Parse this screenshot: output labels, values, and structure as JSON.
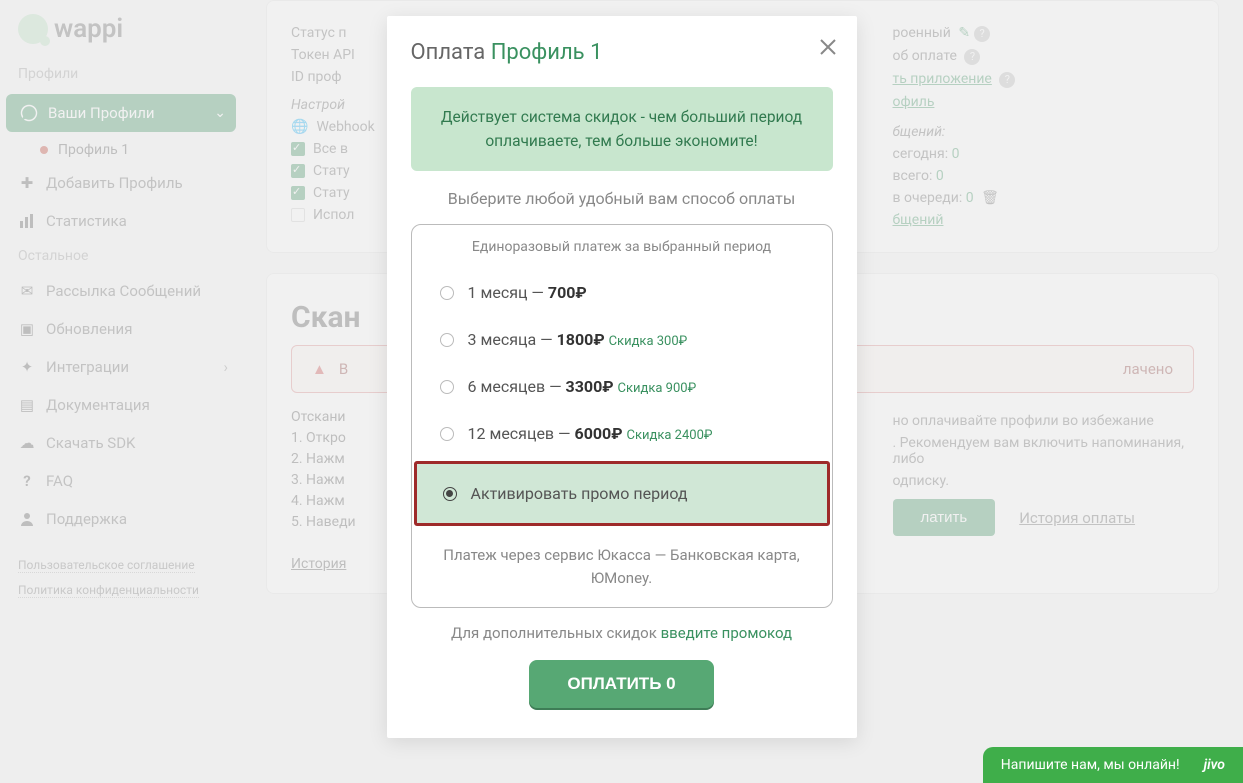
{
  "brand": {
    "name": "wappi"
  },
  "sidebar": {
    "section_profiles": "Профили",
    "your_profiles": "Ваши Профили",
    "sub_profile1": "Профиль 1",
    "add_profile": "Добавить Профиль",
    "stats": "Статистика",
    "section_other": "Остальное",
    "broadcast": "Рассылка Сообщений",
    "updates": "Обновления",
    "integrations": "Интеграции",
    "docs": "Документация",
    "sdk": "Скачать SDK",
    "faq": "FAQ",
    "support": "Поддержка",
    "tos": "Пользовательское соглашение",
    "privacy": "Политика конфиденциальности"
  },
  "profile_card": {
    "status_label": "Статус п",
    "token_label": "Токен API",
    "id_label": "ID проф",
    "settings_label": "Настрой",
    "webhook": "Webhook",
    "all_in": "Все в",
    "status1": "Стату",
    "status2": "Стату",
    "use": "Испол",
    "right_col": {
      "state": "роенный",
      "about_pay": "об оплате",
      "app_label": "ть приложение",
      "profile_label": "офиль",
      "messages_label": "бщений:",
      "today_label": "сегодня:",
      "today_val": "0",
      "total_label": "всего:",
      "total_val": "0",
      "queue_label": "в очереди:",
      "queue_val": "0",
      "messages_link": "бщений"
    }
  },
  "scan": {
    "title": "Скан",
    "alert": "лачено",
    "pay_button": "латить",
    "history": "История оплаты",
    "desc_line": "Отскани",
    "step1": "1. Откро",
    "step2": "2. Нажм",
    "step3": "3. Нажм",
    "step4": "4. Нажм",
    "step5": "5. Наведи",
    "history_link": "История",
    "note1": "но оплачивайте профили во избежание",
    "note2": ". Рекомендуем вам включить напоминания, либо",
    "note3": "одписку."
  },
  "alert_icon": "▲",
  "modal": {
    "title_prefix": "Оплата",
    "profile": "Профиль 1",
    "banner": "Действует система скидок - чем больший период оплачиваете, тем больше экономите!",
    "choose_method": "Выберите любой удобный вам способ оплаты",
    "card_title": "Единоразовый платеж за выбранный период",
    "options": [
      {
        "period": "1 месяц",
        "price": "700₽",
        "discount": ""
      },
      {
        "period": "3 месяца",
        "price": "1800₽",
        "discount": "Скидка 300₽"
      },
      {
        "period": "6 месяцев",
        "price": "3300₽",
        "discount": "Скидка 900₽"
      },
      {
        "period": "12 месяцев",
        "price": "6000₽",
        "discount": "Скидка 2400₽"
      }
    ],
    "promo_option": "Активировать промо период",
    "yukassa": "Платеж через сервис Юкасса — Банковская карта, ЮMoney.",
    "promo_prefix": "Для дополнительных скидок ",
    "promo_link": "введите промокод",
    "pay_button": "ОПЛАТИТЬ 0"
  },
  "jivo": {
    "text": "Напишите нам, мы онлайн!",
    "brand": "jivo"
  }
}
